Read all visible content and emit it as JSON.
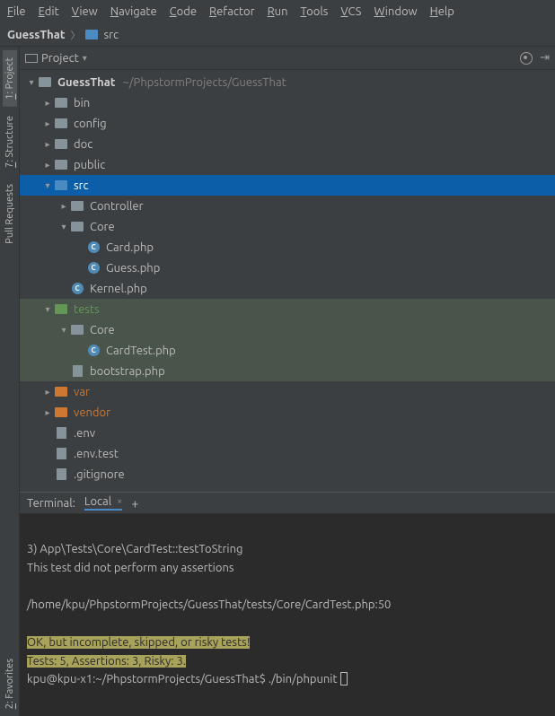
{
  "menu": [
    "File",
    "Edit",
    "View",
    "Navigate",
    "Code",
    "Refactor",
    "Run",
    "Tools",
    "VCS",
    "Window",
    "Help"
  ],
  "breadcrumb": {
    "project": "GuessThat",
    "folder": "src"
  },
  "project_panel_label": "Project",
  "left_tabs": [
    {
      "label": "1: Project",
      "active": true
    },
    {
      "label": "7: Structure",
      "active": false
    },
    {
      "label": "Pull Requests",
      "active": false
    },
    {
      "label": "2: Favorites",
      "active": false
    }
  ],
  "tree": [
    {
      "depth": 0,
      "chev": "open",
      "icon": "folder",
      "name": "GuessThat",
      "bold": true,
      "path": "~/PhpstormProjects/GuessThat"
    },
    {
      "depth": 1,
      "chev": "closed",
      "icon": "folder",
      "name": "bin"
    },
    {
      "depth": 1,
      "chev": "closed",
      "icon": "folder",
      "name": "config"
    },
    {
      "depth": 1,
      "chev": "closed",
      "icon": "folder",
      "name": "doc"
    },
    {
      "depth": 1,
      "chev": "closed",
      "icon": "folder",
      "name": "public"
    },
    {
      "depth": 1,
      "chev": "open",
      "icon": "folder-blue",
      "name": "src",
      "selected": true
    },
    {
      "depth": 2,
      "chev": "closed",
      "icon": "folder",
      "name": "Controller"
    },
    {
      "depth": 2,
      "chev": "open",
      "icon": "folder",
      "name": "Core"
    },
    {
      "depth": 3,
      "chev": "",
      "icon": "php",
      "name": "Card.php"
    },
    {
      "depth": 3,
      "chev": "",
      "icon": "php",
      "name": "Guess.php"
    },
    {
      "depth": 2,
      "chev": "",
      "icon": "php",
      "name": "Kernel.php"
    },
    {
      "depth": 1,
      "chev": "open",
      "icon": "folder-green",
      "name": "tests",
      "hilite": "green",
      "nameColor": "green"
    },
    {
      "depth": 2,
      "chev": "open",
      "icon": "folder",
      "name": "Core",
      "hilite": "green"
    },
    {
      "depth": 3,
      "chev": "",
      "icon": "php",
      "name": "CardTest.php",
      "hilite": "green"
    },
    {
      "depth": 2,
      "chev": "",
      "icon": "file",
      "name": "bootstrap.php",
      "hilite": "green"
    },
    {
      "depth": 1,
      "chev": "closed",
      "icon": "folder-orange",
      "name": "var",
      "nameColor": "orange"
    },
    {
      "depth": 1,
      "chev": "closed",
      "icon": "folder-orange",
      "name": "vendor",
      "nameColor": "orange"
    },
    {
      "depth": 1,
      "chev": "",
      "icon": "file",
      "name": ".env"
    },
    {
      "depth": 1,
      "chev": "",
      "icon": "file",
      "name": ".env.test"
    },
    {
      "depth": 1,
      "chev": "",
      "icon": "file",
      "name": ".gitignore"
    }
  ],
  "terminal": {
    "label": "Terminal:",
    "tab": "Local",
    "lines": [
      {
        "t": ""
      },
      {
        "t": "3) App\\Tests\\Core\\CardTest::testToString"
      },
      {
        "t": "This test did not perform any assertions"
      },
      {
        "t": ""
      },
      {
        "t": "/home/kpu/PhpstormProjects/GuessThat/tests/Core/CardTest.php:50"
      },
      {
        "t": ""
      },
      {
        "t": "OK, but incomplete, skipped, or risky tests!",
        "hl": true
      },
      {
        "t": "Tests: 5, Assertions: 3, Risky: 3.",
        "hl": true
      },
      {
        "prompt": "kpu@kpu-x1:~/PhpstormProjects/GuessThat$ ",
        "cmd": "./bin/phpunit ",
        "cursor": true
      }
    ]
  }
}
